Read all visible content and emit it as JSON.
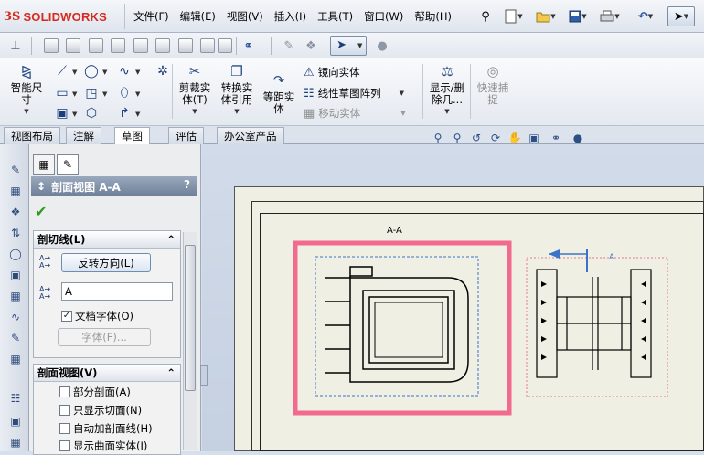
{
  "app": {
    "logo_prefix": "3S",
    "logo_text": "SOLIDWORKS"
  },
  "menu": [
    "文件(F)",
    "编辑(E)",
    "视图(V)",
    "插入(I)",
    "工具(T)",
    "窗口(W)",
    "帮助(H)"
  ],
  "sketch_tools": {
    "smart_dimension": "智能尺\n寸",
    "trim": "剪裁实\n体(T)",
    "convert": "转换实\n体引用",
    "offset": "等距实\n体",
    "mirror": "镜向实体",
    "linear_pattern": "线性草图阵列",
    "move": "移动实体",
    "display_delete": "显示/删\n除几...",
    "quick_snap": "快速捕\n捉"
  },
  "tabs": [
    "视图布局",
    "注解",
    "草图",
    "评估",
    "办公室产品"
  ],
  "active_tab": "草图",
  "property_manager": {
    "title": "剖面视图 A-A",
    "help": "?",
    "cut_line_group": "剖切线(L)",
    "reverse_button": "反转方向(L)",
    "label_value": "A",
    "document_font": "文档字体(O)",
    "font_button": "字体(F)...",
    "section_view_group": "剖面视图(V)",
    "options": [
      {
        "label": "部分剖面(A)",
        "checked": false
      },
      {
        "label": "只显示切面(N)",
        "checked": false
      },
      {
        "label": "自动加剖面线(H)",
        "checked": false
      },
      {
        "label": "显示曲面实体(I)",
        "checked": false
      }
    ]
  },
  "drawing": {
    "view_label": "A-A",
    "section_arrow_label": "A",
    "highlight_color": "#f06b8e"
  }
}
